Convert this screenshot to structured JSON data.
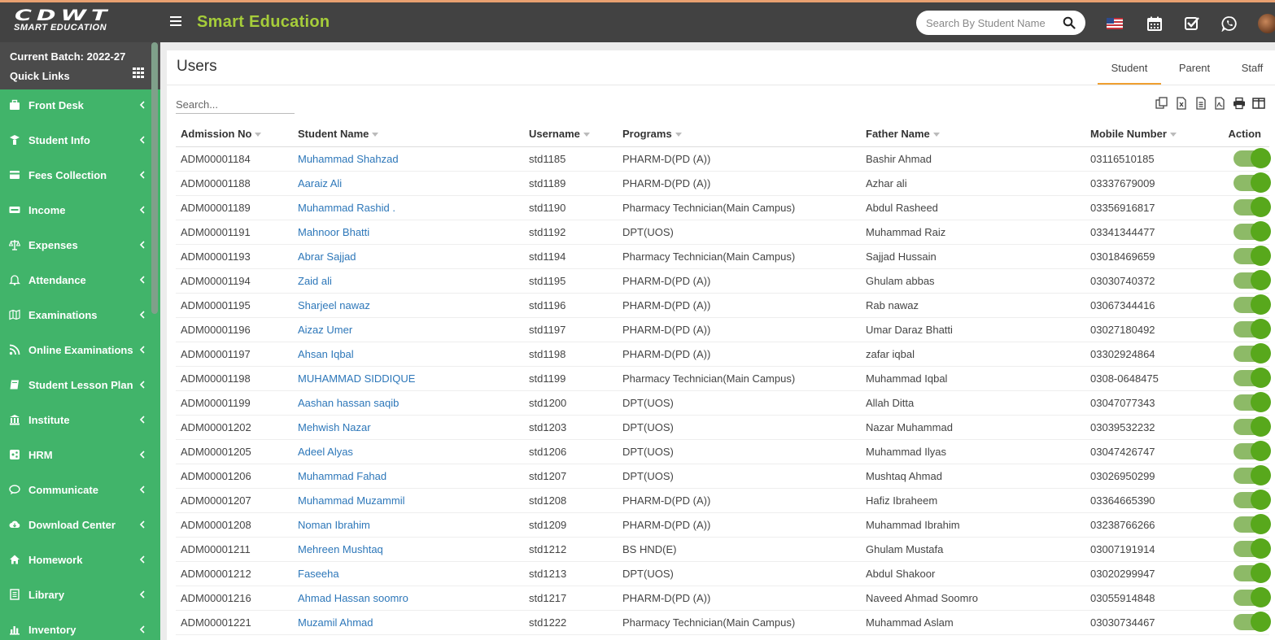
{
  "header": {
    "logo_main": "CDWT",
    "logo_sub": "SMART EDUCATION",
    "app_title": "Smart Education",
    "search_placeholder": "Search By Student Name"
  },
  "sidebar": {
    "batch_label": "Current Batch: 2022-27",
    "quick_links_label": "Quick Links",
    "items": [
      {
        "label": "Front Desk",
        "icon": "briefcase-icon"
      },
      {
        "label": "Student Info",
        "icon": "graduate-icon"
      },
      {
        "label": "Fees Collection",
        "icon": "credit-card-icon"
      },
      {
        "label": "Income",
        "icon": "visa-card-icon"
      },
      {
        "label": "Expenses",
        "icon": "scale-icon"
      },
      {
        "label": "Attendance",
        "icon": "bell-icon"
      },
      {
        "label": "Examinations",
        "icon": "map-icon"
      },
      {
        "label": "Online Examinations",
        "icon": "rss-icon"
      },
      {
        "label": "Student Lesson Plan",
        "icon": "book-icon"
      },
      {
        "label": "Institute",
        "icon": "bank-icon"
      },
      {
        "label": "HRM",
        "icon": "sitemap-icon"
      },
      {
        "label": "Communicate",
        "icon": "chat-icon"
      },
      {
        "label": "Download Center",
        "icon": "cloud-download-icon"
      },
      {
        "label": "Homework",
        "icon": "home-icon"
      },
      {
        "label": "Library",
        "icon": "library-book-icon"
      },
      {
        "label": "Inventory",
        "icon": "bar-chart-icon"
      }
    ]
  },
  "main": {
    "title": "Users",
    "tabs": [
      "Student",
      "Parent",
      "Staff"
    ],
    "active_tab": "Student",
    "table_search_placeholder": "Search...",
    "tools": [
      "copy-icon",
      "excel-icon",
      "csv-icon",
      "pdf-icon",
      "print-icon",
      "columns-icon"
    ],
    "columns": [
      "Admission No",
      "Student Name",
      "Username",
      "Programs",
      "Father Name",
      "Mobile Number",
      "Action"
    ],
    "rows": [
      [
        "ADM00001184",
        "Muhammad Shahzad",
        "std1185",
        "PHARM-D(PD (A))",
        "Bashir Ahmad",
        "03116510185"
      ],
      [
        "ADM00001188",
        "Aaraiz Ali",
        "std1189",
        "PHARM-D(PD (A))",
        "Azhar ali",
        "03337679009"
      ],
      [
        "ADM00001189",
        "Muhammad Rashid .",
        "std1190",
        "Pharmacy Technician(Main Campus)",
        "Abdul Rasheed",
        "03356916817"
      ],
      [
        "ADM00001191",
        "Mahnoor Bhatti",
        "std1192",
        "DPT(UOS)",
        "Muhammad Raiz",
        "03341344477"
      ],
      [
        "ADM00001193",
        "Abrar Sajjad",
        "std1194",
        "Pharmacy Technician(Main Campus)",
        "Sajjad Hussain",
        "03018469659"
      ],
      [
        "ADM00001194",
        "Zaid ali",
        "std1195",
        "PHARM-D(PD (A))",
        "Ghulam abbas",
        "03030740372"
      ],
      [
        "ADM00001195",
        "Sharjeel nawaz",
        "std1196",
        "PHARM-D(PD (A))",
        "Rab nawaz",
        "03067344416"
      ],
      [
        "ADM00001196",
        "Aizaz Umer",
        "std1197",
        "PHARM-D(PD (A))",
        "Umar Daraz Bhatti",
        "03027180492"
      ],
      [
        "ADM00001197",
        "Ahsan Iqbal",
        "std1198",
        "PHARM-D(PD (A))",
        "zafar iqbal",
        "03302924864"
      ],
      [
        "ADM00001198",
        "MUHAMMAD SIDDIQUE",
        "std1199",
        "Pharmacy Technician(Main Campus)",
        "Muhammad Iqbal",
        "0308-0648475"
      ],
      [
        "ADM00001199",
        "Aashan hassan saqib",
        "std1200",
        "DPT(UOS)",
        "Allah Ditta",
        "03047077343"
      ],
      [
        "ADM00001202",
        "Mehwish Nazar",
        "std1203",
        "DPT(UOS)",
        "Nazar Muhammad",
        "03039532232"
      ],
      [
        "ADM00001205",
        "Adeel Alyas",
        "std1206",
        "DPT(UOS)",
        "Muhammad Ilyas",
        "03047426747"
      ],
      [
        "ADM00001206",
        "Muhammad Fahad",
        "std1207",
        "DPT(UOS)",
        "Mushtaq Ahmad",
        "03026950299"
      ],
      [
        "ADM00001207",
        "Muhammad Muzammil",
        "std1208",
        "PHARM-D(PD (A))",
        "Hafiz Ibraheem",
        "03364665390"
      ],
      [
        "ADM00001208",
        "Noman Ibrahim",
        "std1209",
        "PHARM-D(PD (A))",
        "Muhammad Ibrahim",
        "03238766266"
      ],
      [
        "ADM00001211",
        "Mehreen Mushtaq",
        "std1212",
        "BS HND(E)",
        "Ghulam Mustafa",
        "03007191914"
      ],
      [
        "ADM00001212",
        "Faseeha",
        "std1213",
        "DPT(UOS)",
        "Abdul Shakoor",
        "03020299947"
      ],
      [
        "ADM00001216",
        "Ahmad Hassan soomro",
        "std1217",
        "PHARM-D(PD (A))",
        "Naveed Ahmad Soomro",
        "03055914848"
      ],
      [
        "ADM00001221",
        "Muzamil Ahmad",
        "std1222",
        "Pharmacy Technician(Main Campus)",
        "Muhammad Aslam",
        "03030734467"
      ]
    ]
  },
  "colors": {
    "topbar": "#424242",
    "sidebar": "#41b46a",
    "title_accent": "#a6cd3a",
    "link": "#2d77b9",
    "tab_underline": "#f0a030",
    "toggle_on": "#58a81c"
  }
}
